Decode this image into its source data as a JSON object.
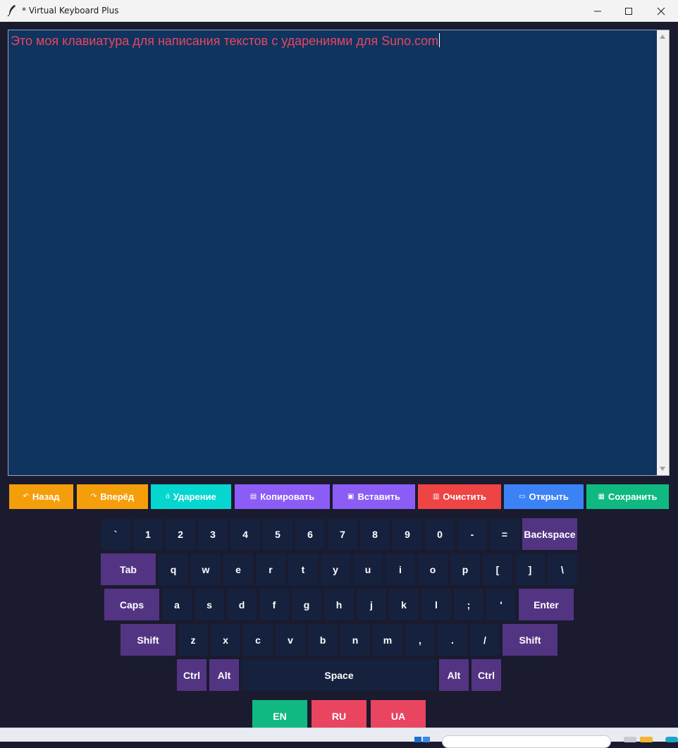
{
  "window": {
    "title": "* Virtual Keyboard Plus",
    "controls": {
      "minimize": "minimize-icon",
      "maximize": "maximize-icon",
      "close": "close-icon"
    }
  },
  "editor": {
    "text": "Это моя клавиатура для написания текстов с ударениями для Suno.com",
    "text_color": "#e94560",
    "background": "#0f3460"
  },
  "toolbar": {
    "back": {
      "icon": "undo-icon",
      "glyph": "↶",
      "label": "Назад",
      "color": "#f59e0b"
    },
    "forward": {
      "icon": "redo-icon",
      "glyph": "↷",
      "label": "Вперёд",
      "color": "#f59e0b"
    },
    "stress": {
      "icon": "stress-icon",
      "glyph": "ó",
      "label": "Ударение",
      "color": "#06d6d0"
    },
    "copy": {
      "icon": "copy-icon",
      "glyph": "▤",
      "label": "Копировать",
      "color": "#8b5cf6"
    },
    "paste": {
      "icon": "paste-icon",
      "glyph": "▣",
      "label": "Вставить",
      "color": "#8b5cf6"
    },
    "clear": {
      "icon": "trash-icon",
      "glyph": "▥",
      "label": "Очистить",
      "color": "#ef4444"
    },
    "open": {
      "icon": "folder-icon",
      "glyph": "▭",
      "label": "Открыть",
      "color": "#3b82f6"
    },
    "save": {
      "icon": "save-icon",
      "glyph": "▦",
      "label": "Сохранить",
      "color": "#10b981"
    }
  },
  "keyboard": {
    "key_color": "#16213e",
    "mod_color": "#533483",
    "row1": [
      "`",
      "1",
      "2",
      "3",
      "4",
      "5",
      "6",
      "7",
      "8",
      "9",
      "0",
      "-",
      "=",
      "Backspace"
    ],
    "row2": [
      "Tab",
      "q",
      "w",
      "e",
      "r",
      "t",
      "y",
      "u",
      "i",
      "o",
      "p",
      "[",
      "]",
      "\\"
    ],
    "row3": [
      "Caps",
      "a",
      "s",
      "d",
      "f",
      "g",
      "h",
      "j",
      "k",
      "l",
      ";",
      "'",
      "Enter"
    ],
    "row4": [
      "Shift",
      "z",
      "x",
      "c",
      "v",
      "b",
      "n",
      "m",
      ",",
      ".",
      "/",
      "Shift"
    ],
    "row5": [
      "Ctrl",
      "Alt",
      "Space",
      "Alt",
      "Ctrl"
    ]
  },
  "languages": [
    {
      "label": "EN",
      "color": "#10b981"
    },
    {
      "label": "RU",
      "color": "#e94560"
    },
    {
      "label": "UA",
      "color": "#e94560"
    }
  ]
}
